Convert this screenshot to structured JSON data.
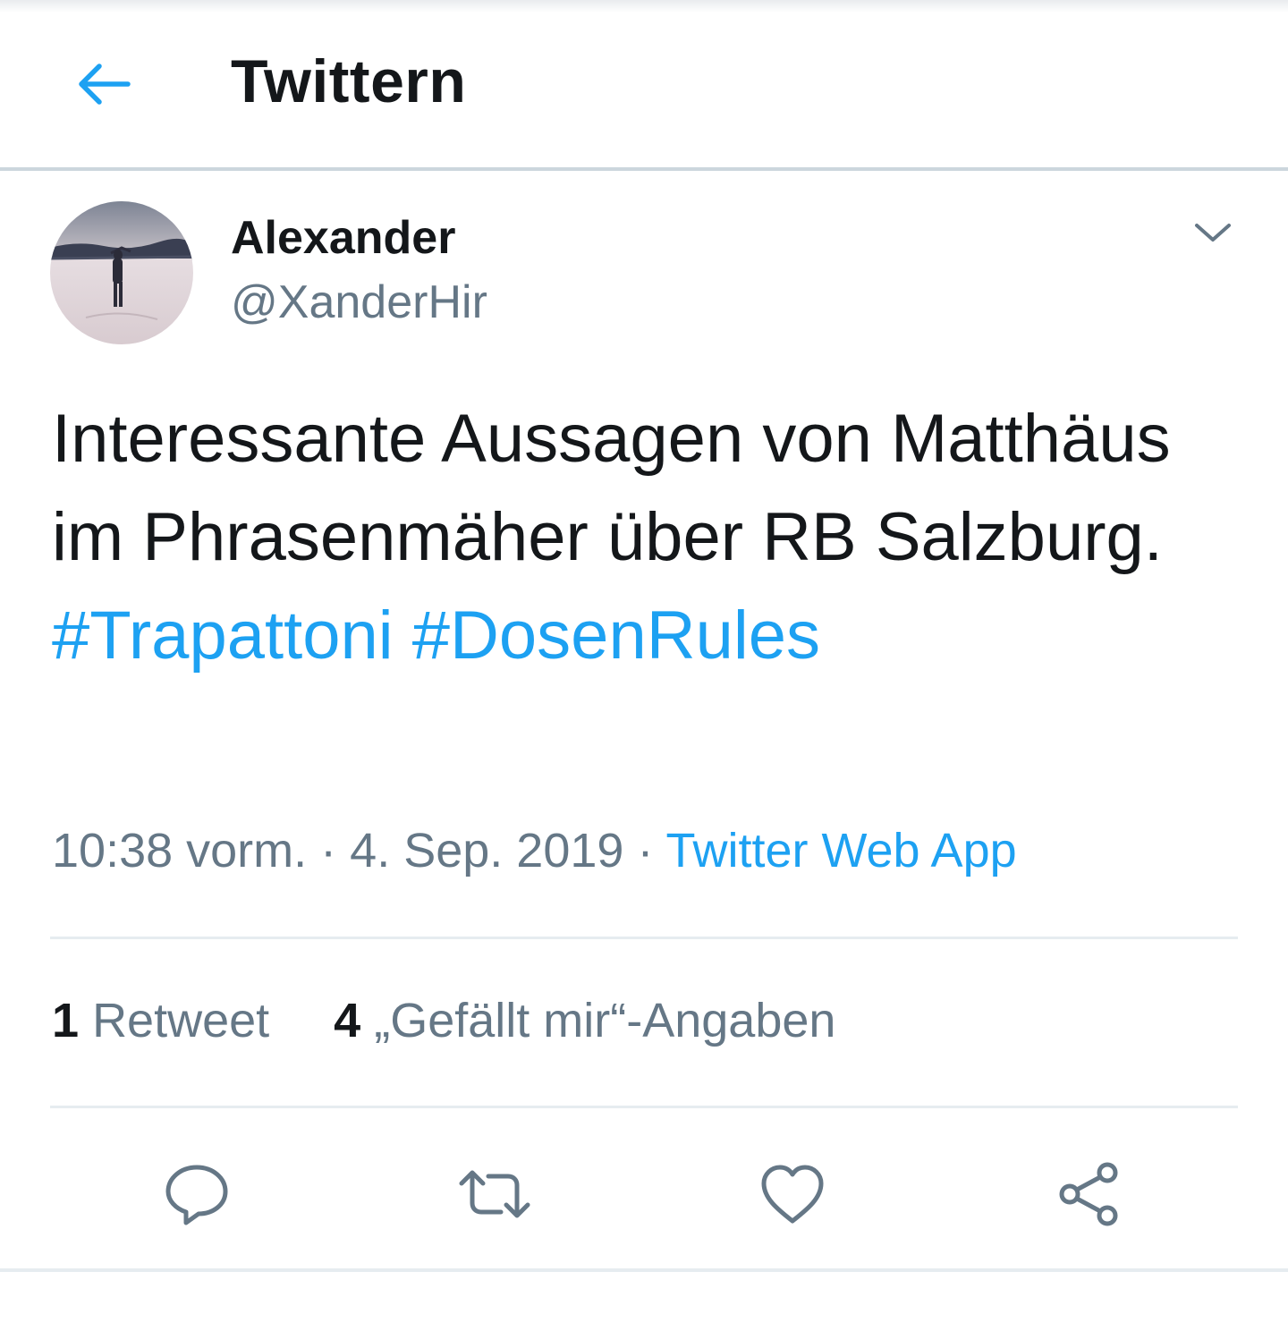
{
  "header": {
    "title": "Twittern",
    "back_icon": "arrow-left-icon"
  },
  "colors": {
    "accent": "#1da1f2",
    "text": "#14171a",
    "secondary_text": "#657786",
    "divider": "#e6ecf0"
  },
  "tweet": {
    "author": {
      "name": "Alexander",
      "handle": "@XanderHir",
      "avatar": "avatar-photo"
    },
    "menu_icon": "chevron-down-icon",
    "text": "Interessante Aussagen von Matthäus im Phrasenmäher über RB Salzburg. ",
    "hashtags": [
      "#Trapattoni",
      "#DosenRules"
    ],
    "time": "10:38 vorm.",
    "date": "4. Sep. 2019",
    "separator": "·",
    "source": "Twitter Web App",
    "stats": {
      "retweets_count": "1",
      "retweets_label": "Retweet",
      "likes_count": "4",
      "likes_label": "„Gefällt mir“-Angaben"
    },
    "actions": [
      {
        "icon": "reply-icon"
      },
      {
        "icon": "retweet-icon"
      },
      {
        "icon": "heart-icon"
      },
      {
        "icon": "share-icon"
      }
    ]
  }
}
